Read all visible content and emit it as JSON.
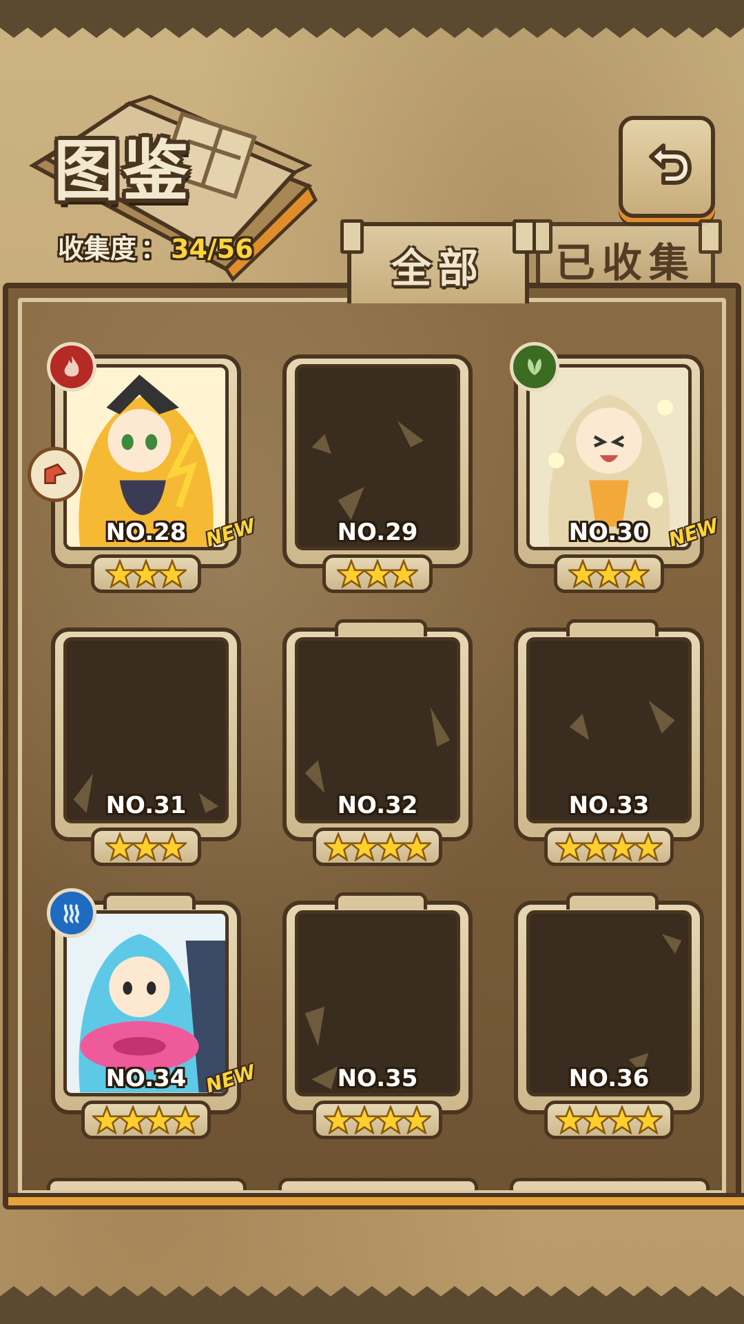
{
  "header": {
    "title": "图鉴",
    "collection_label": "收集度",
    "collection_separator": "：",
    "collection_value": "34/56",
    "back_icon": "return-arrow-icon"
  },
  "tabs": [
    {
      "label": "全部",
      "active": true
    },
    {
      "label": "已收集",
      "active": false
    }
  ],
  "new_label": "NEW",
  "cards": [
    {
      "number": "NO.28",
      "stars": 3,
      "collected": true,
      "is_new": true,
      "element": "fire",
      "portrait_desc": "golden-haired warrior"
    },
    {
      "number": "NO.29",
      "stars": 3,
      "collected": false,
      "is_new": false
    },
    {
      "number": "NO.30",
      "stars": 3,
      "collected": true,
      "is_new": true,
      "element": "wood",
      "portrait_desc": "light fairy"
    },
    {
      "number": "NO.31",
      "stars": 3,
      "collected": false,
      "is_new": false
    },
    {
      "number": "NO.32",
      "stars": 4,
      "collected": false,
      "is_new": false
    },
    {
      "number": "NO.33",
      "stars": 4,
      "collected": false,
      "is_new": false
    },
    {
      "number": "NO.34",
      "stars": 4,
      "collected": true,
      "is_new": true,
      "element": "water",
      "portrait_desc": "girl with swim ring"
    },
    {
      "number": "NO.35",
      "stars": 4,
      "collected": false,
      "is_new": false
    },
    {
      "number": "NO.36",
      "stars": 4,
      "collected": false,
      "is_new": false
    }
  ],
  "colors": {
    "accent_yellow": "#ffd43b",
    "frame_dark": "#4a3520",
    "fire": "#b52a24",
    "wood": "#3c6b22",
    "water": "#1f6bc1"
  }
}
